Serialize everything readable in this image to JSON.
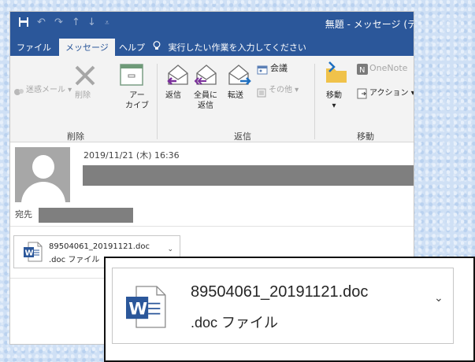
{
  "colors": {
    "accent": "#2b579a",
    "ribbon_bg": "#f3f3f3",
    "redact": "#7f7f7f",
    "word_blue": "#2b579a"
  },
  "window": {
    "title": "無題 - メッセージ (テ"
  },
  "qat": {
    "save_icon": "save-icon",
    "undo_icon": "undo-icon",
    "redo_icon": "redo-icon",
    "up_icon": "up-arrow-icon",
    "down_icon": "down-arrow-icon",
    "customize_icon": "customize-icon"
  },
  "tabs": [
    {
      "label": "ファイル",
      "active": false
    },
    {
      "label": "メッセージ",
      "active": true
    },
    {
      "label": "ヘルプ",
      "active": false
    }
  ],
  "tellme": {
    "label": "実行したい作業を入力してください"
  },
  "ribbon": {
    "delete_group": {
      "label": "削除",
      "junk": "迷惑メール",
      "delete": "削除",
      "archive_line1": "アー",
      "archive_line2": "カイブ"
    },
    "respond_group": {
      "label": "返信",
      "reply": "返信",
      "reply_all_line1": "全員に",
      "reply_all_line2": "返信",
      "forward": "転送",
      "meeting": "会議",
      "more": "その他"
    },
    "move_group": {
      "label": "移動",
      "move": "移動",
      "onenote": "OneNote",
      "actions": "アクション"
    }
  },
  "message": {
    "date": "2019/11/21 (木) 16:36",
    "to_label": "宛先"
  },
  "attachment": {
    "filename": "89504061_20191121.doc",
    "filetype": ".doc ファイル"
  }
}
